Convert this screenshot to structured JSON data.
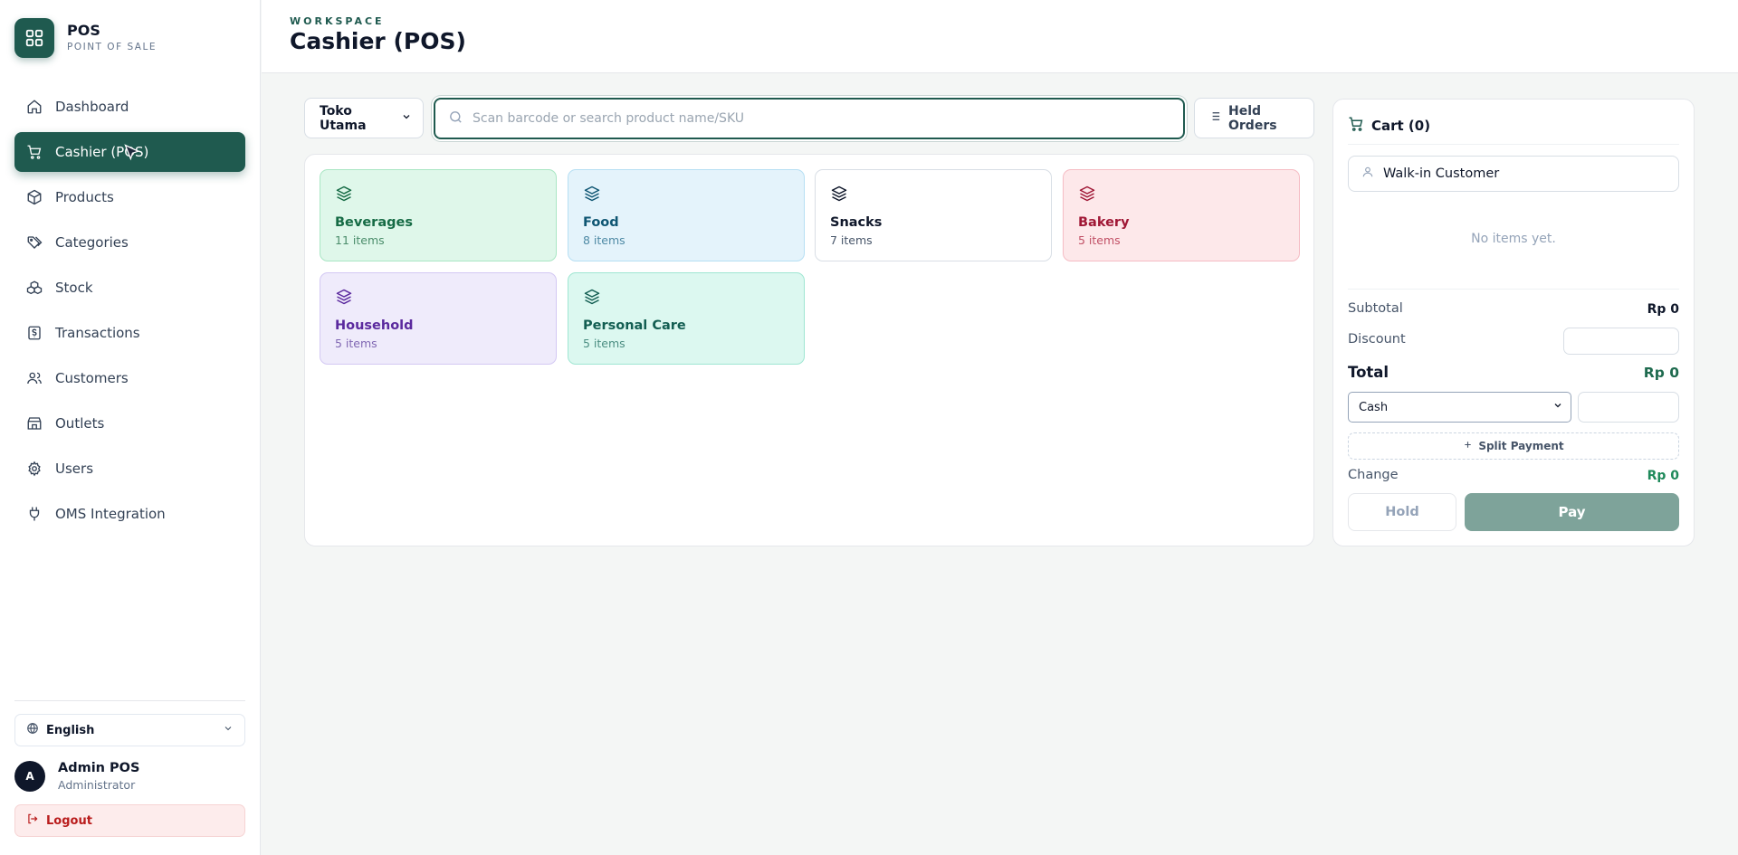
{
  "brand": {
    "title": "POS",
    "subtitle": "POINT OF SALE",
    "icon": "grid-icon",
    "color": "#1f5a4f"
  },
  "nav": {
    "items": [
      {
        "label": "Dashboard",
        "icon": "home-icon",
        "active": false
      },
      {
        "label": "Cashier (POS)",
        "icon": "cart-icon",
        "active": true
      },
      {
        "label": "Products",
        "icon": "box-icon",
        "active": false
      },
      {
        "label": "Categories",
        "icon": "tags-icon",
        "active": false
      },
      {
        "label": "Stock",
        "icon": "boxes-icon",
        "active": false
      },
      {
        "label": "Transactions",
        "icon": "receipt-icon",
        "active": false
      },
      {
        "label": "Customers",
        "icon": "users-icon",
        "active": false
      },
      {
        "label": "Outlets",
        "icon": "store-icon",
        "active": false
      },
      {
        "label": "Users",
        "icon": "gear-icon",
        "active": false
      },
      {
        "label": "OMS Integration",
        "icon": "plug-icon",
        "active": false
      }
    ]
  },
  "language": {
    "label": "English",
    "icon": "globe-icon"
  },
  "user": {
    "initial": "A",
    "name": "Admin POS",
    "role": "Administrator"
  },
  "logout": {
    "label": "Logout",
    "icon": "logout-icon"
  },
  "header": {
    "eyebrow": "WORKSPACE",
    "title": "Cashier (POS)"
  },
  "toolbar": {
    "outlet": "Toko Utama",
    "search_placeholder": "Scan barcode or search product name/SKU",
    "search_value": "",
    "held_orders_label": "Held Orders"
  },
  "categories": [
    {
      "name": "Beverages",
      "count": "11 items",
      "bg": "#dff7ea",
      "border": "#a9e6c4",
      "text": "#166b45",
      "sub": "#4b8d6b",
      "icon": "#166b45"
    },
    {
      "name": "Food",
      "count": "8 items",
      "bg": "#e4f3fb",
      "border": "#b6dff3",
      "text": "#0f5673",
      "sub": "#4f8aa5",
      "icon": "#0f5673"
    },
    {
      "name": "Snacks",
      "count": "7 items",
      "bg": "#ffffff",
      "border": "#d8dee5",
      "text": "#0f172a",
      "sub": "#475569",
      "icon": "#0f172a"
    },
    {
      "name": "Bakery",
      "count": "5 items",
      "bg": "#fde8ea",
      "border": "#f5bcc4",
      "text": "#a01836",
      "sub": "#c15066",
      "icon": "#a01836"
    },
    {
      "name": "Household",
      "count": "5 items",
      "bg": "#efebfb",
      "border": "#d3c8f3",
      "text": "#5b2a9e",
      "sub": "#8067b3",
      "icon": "#5b2a9e"
    },
    {
      "name": "Personal Care",
      "count": "5 items",
      "bg": "#dcf8f0",
      "border": "#9fe6d2",
      "text": "#135e52",
      "sub": "#4c8e82",
      "icon": "#135e52"
    }
  ],
  "cart": {
    "title": "Cart (0)",
    "customer": "Walk-in Customer",
    "empty_text": "No items yet.",
    "subtotal_label": "Subtotal",
    "subtotal_value": "Rp 0",
    "discount_label": "Discount",
    "discount_value": "",
    "total_label": "Total",
    "total_value": "Rp 0",
    "payment_method": "Cash",
    "amount_value": "",
    "split_label": "Split Payment",
    "change_label": "Change",
    "change_value": "Rp 0",
    "hold_label": "Hold",
    "pay_label": "Pay"
  }
}
